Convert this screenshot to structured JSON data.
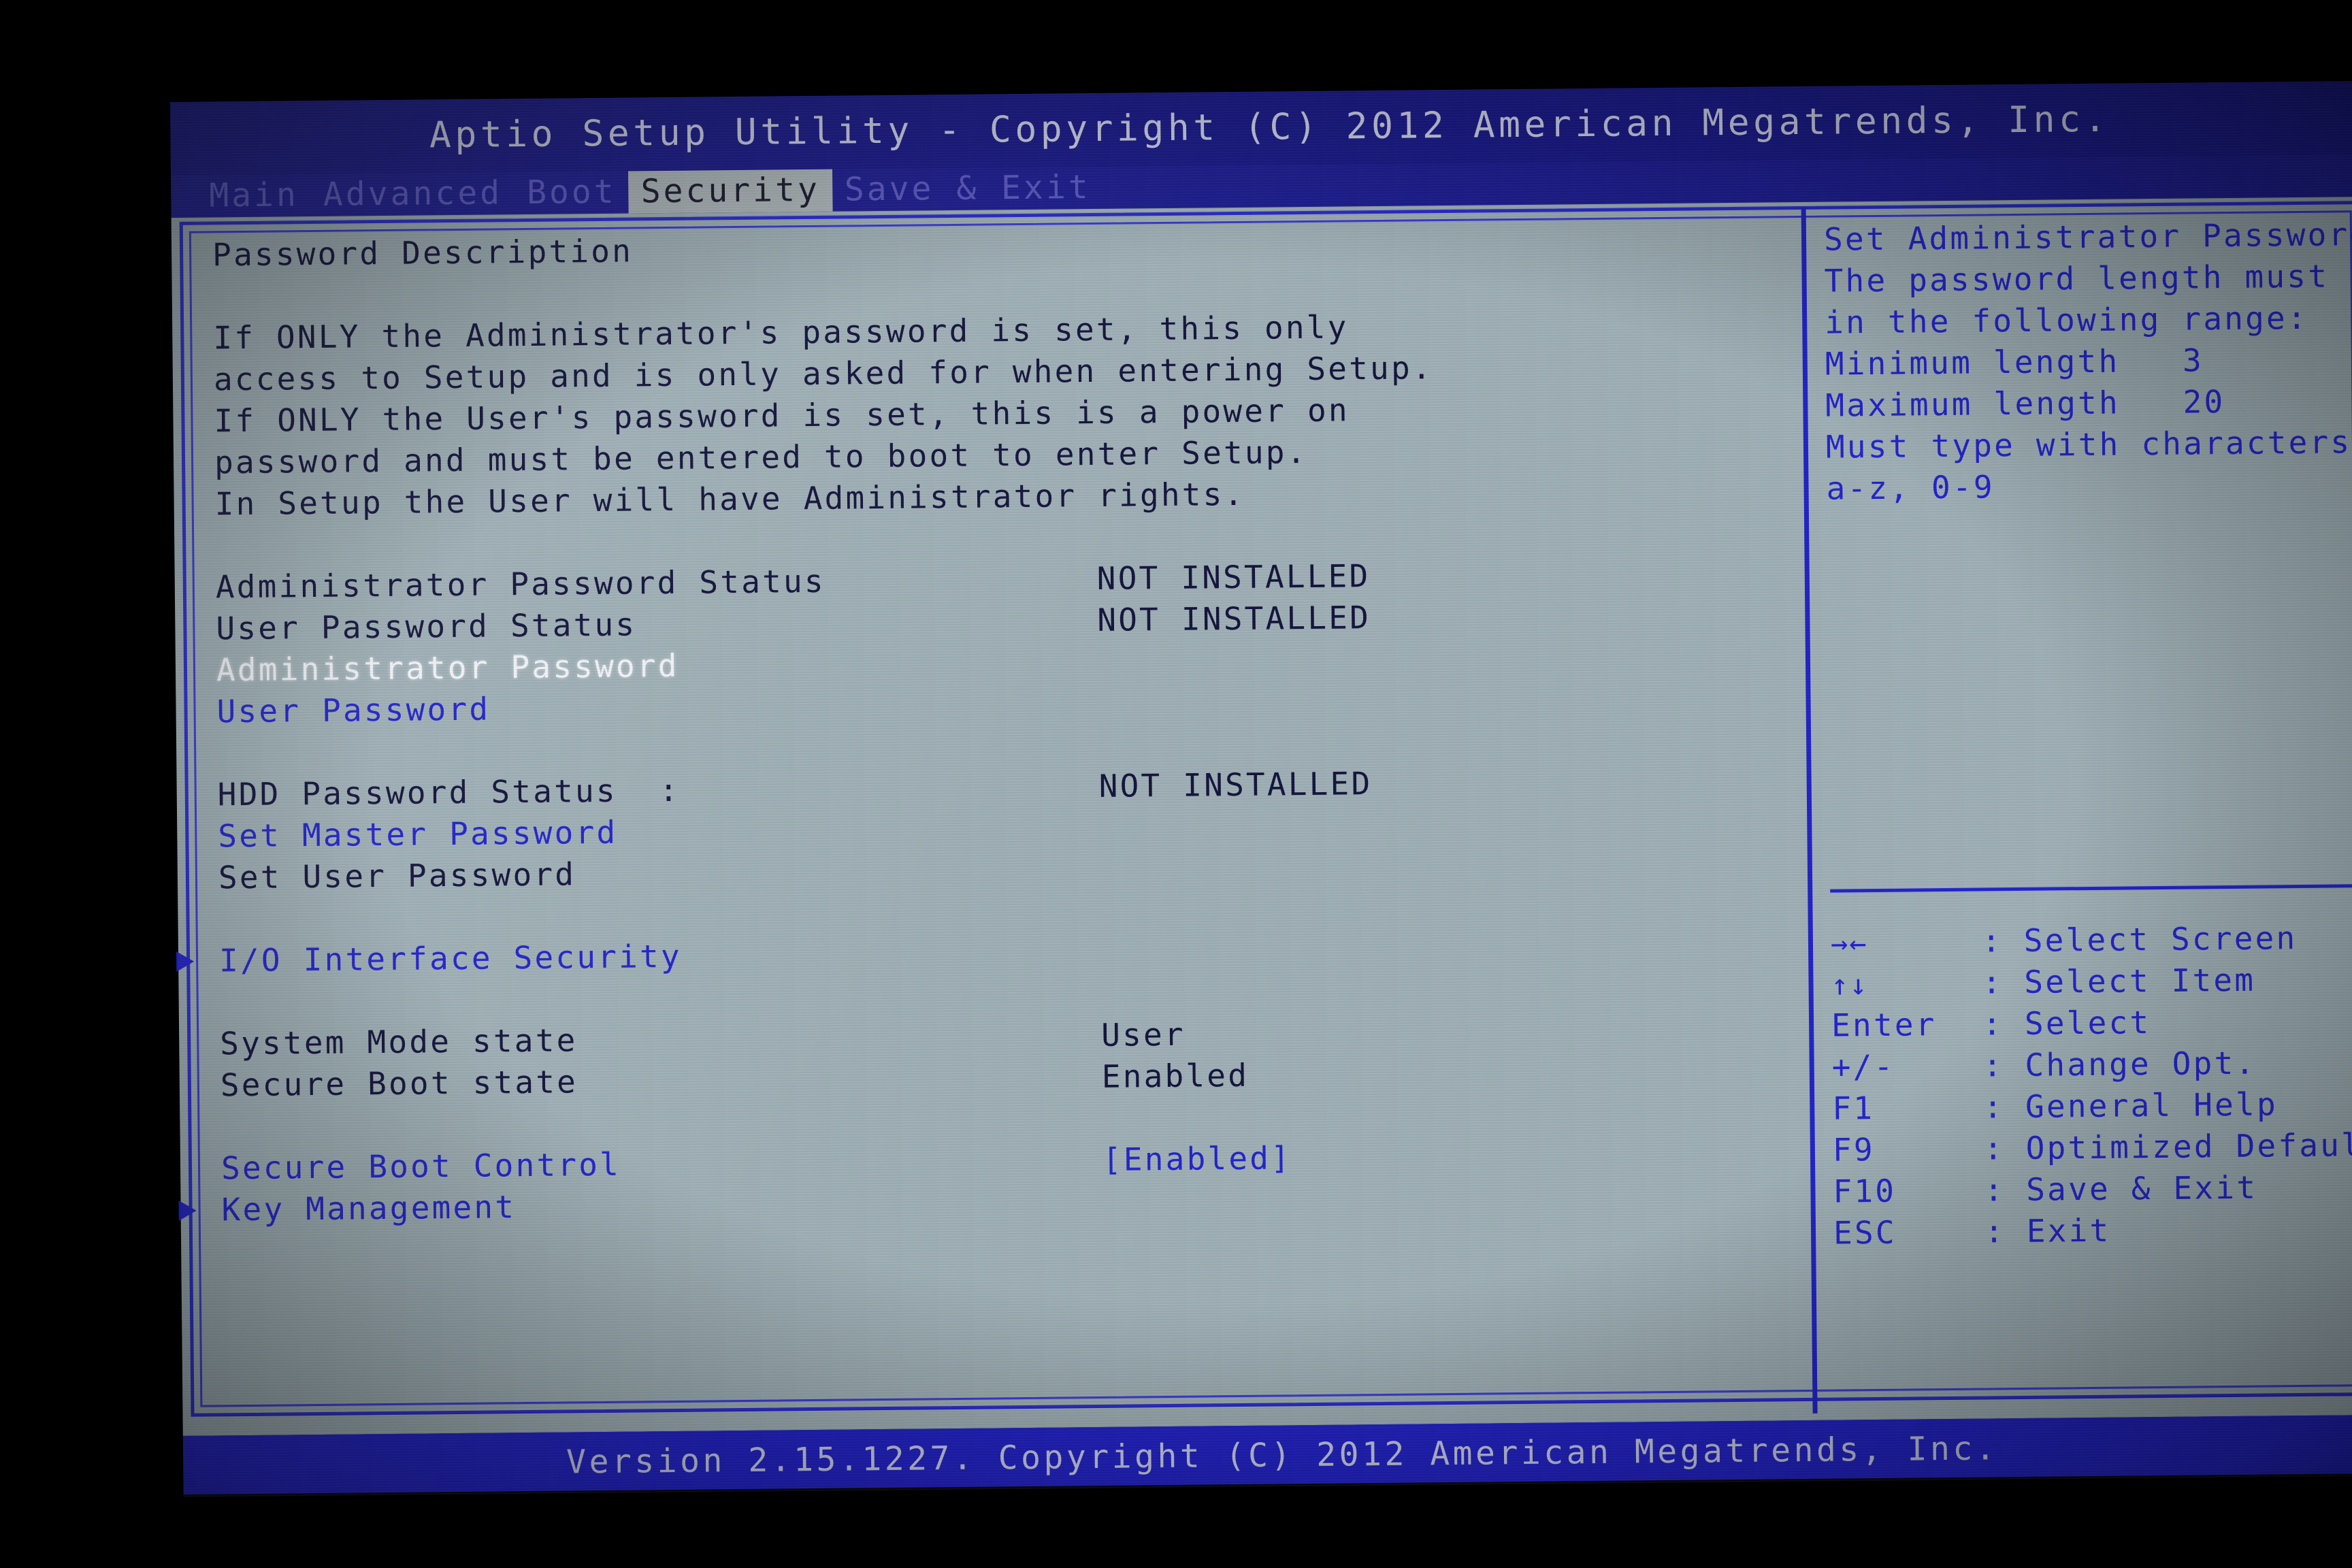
{
  "header": {
    "title": "Aptio Setup Utility - Copyright (C) 2012 American Megatrends, Inc.",
    "tabs": [
      {
        "label": "Main",
        "active": false
      },
      {
        "label": "Advanced",
        "active": false
      },
      {
        "label": "Boot",
        "active": false
      },
      {
        "label": "Security",
        "active": true
      },
      {
        "label": "Save & Exit",
        "active": false
      }
    ]
  },
  "main": {
    "section_title": "Password Description",
    "description_lines": [
      "If ONLY the Administrator's password is set, this only",
      "access to Setup and is only asked for when entering Setup.",
      "If ONLY the User's password is set, this is a power on",
      "password and must be entered to boot to enter Setup.",
      "In Setup the User will have Administrator rights."
    ],
    "items": [
      {
        "label": "Administrator Password Status",
        "value": "NOT INSTALLED",
        "style": "dark",
        "arrow": false
      },
      {
        "label": "User Password Status",
        "value": "NOT INSTALLED",
        "style": "dark",
        "arrow": false
      },
      {
        "label": "Administrator Password",
        "value": "",
        "style": "white",
        "arrow": false
      },
      {
        "label": "User Password",
        "value": "",
        "style": "blue",
        "arrow": false
      },
      {
        "label": "",
        "value": "",
        "style": "dark",
        "arrow": false
      },
      {
        "label": "HDD Password Status  :",
        "value": "NOT INSTALLED",
        "style": "dark",
        "arrow": false
      },
      {
        "label": "Set Master Password",
        "value": "",
        "style": "blue",
        "arrow": false
      },
      {
        "label": "Set User Password",
        "value": "",
        "style": "dark",
        "arrow": false
      },
      {
        "label": "",
        "value": "",
        "style": "dark",
        "arrow": false
      },
      {
        "label": "I/O Interface Security",
        "value": "",
        "style": "blue",
        "arrow": true
      },
      {
        "label": "",
        "value": "",
        "style": "dark",
        "arrow": false
      },
      {
        "label": "System Mode state",
        "value": "User",
        "style": "dark",
        "arrow": false
      },
      {
        "label": "Secure Boot state",
        "value": "Enabled",
        "style": "dark",
        "arrow": false
      },
      {
        "label": "",
        "value": "",
        "style": "dark",
        "arrow": false
      },
      {
        "label": "Secure Boot Control",
        "value": "[Enabled]",
        "style": "blue",
        "arrow": false
      },
      {
        "label": "Key Management",
        "value": "",
        "style": "blue",
        "arrow": true
      }
    ]
  },
  "help": {
    "lines": [
      "Set Administrator Password.",
      "The password length must be",
      "in the following range:",
      "Minimum length   3",
      "Maximum length   20",
      "Must type with characters",
      "a-z, 0-9"
    ],
    "keys": [
      {
        "glyph": "→←",
        "sep": ":",
        "action": "Select Screen"
      },
      {
        "glyph": "↑↓",
        "sep": ":",
        "action": "Select Item"
      },
      {
        "glyph": "Enter",
        "sep": ":",
        "action": "Select"
      },
      {
        "glyph": "+/-",
        "sep": ":",
        "action": "Change Opt."
      },
      {
        "glyph": "F1",
        "sep": ":",
        "action": "General Help"
      },
      {
        "glyph": "F9",
        "sep": ":",
        "action": "Optimized Defaults"
      },
      {
        "glyph": "F10",
        "sep": ":",
        "action": "Save & Exit"
      },
      {
        "glyph": "ESC",
        "sep": ":",
        "action": "Exit"
      }
    ]
  },
  "footer": {
    "version_text": "Version 2.15.1227. Copyright (C) 2012 American Megatrends, Inc."
  },
  "colors": {
    "header_bg": "#1b1b8c",
    "body_bg": "#9fb0b6",
    "accent_blue": "#2323cc",
    "text_dark": "#14143c",
    "selected_white": "#f2f4fa",
    "footer_bg": "#2222c8"
  }
}
